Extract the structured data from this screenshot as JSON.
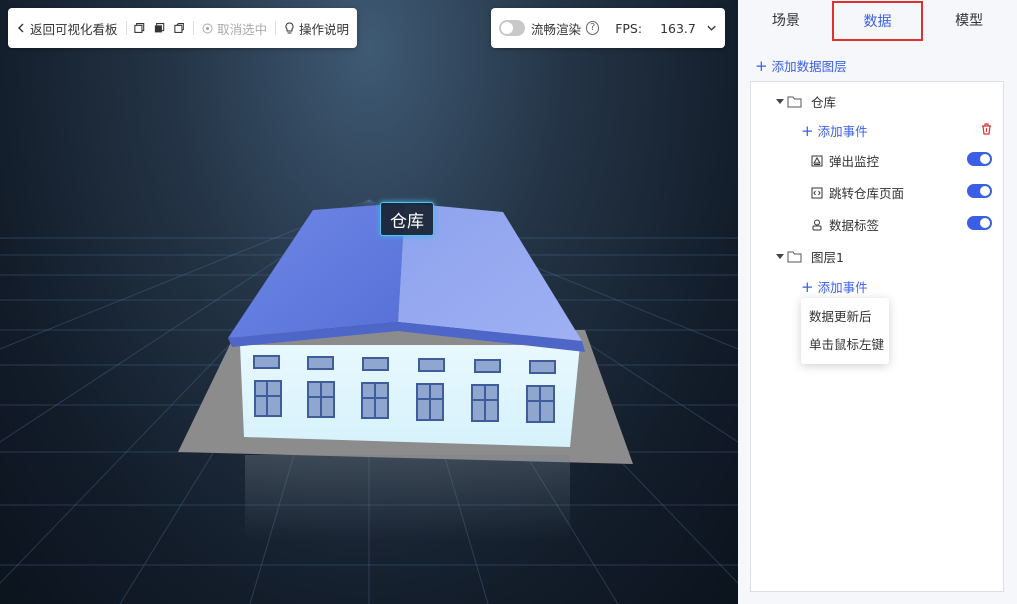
{
  "toolbar": {
    "back_label": "返回可视化看板",
    "cancel_select_label": "取消选中",
    "help_label": "操作说明"
  },
  "fps_bar": {
    "smooth_render_label": "流畅渲染",
    "smooth_render_on": false,
    "fps_label": "FPS:",
    "fps_value": "163.7"
  },
  "scene": {
    "building_label": "仓库"
  },
  "panel": {
    "tabs": [
      {
        "label": "场景",
        "active": false
      },
      {
        "label": "数据",
        "active": true
      },
      {
        "label": "模型",
        "active": false
      }
    ],
    "add_layer_label": "添加数据图层",
    "layers": [
      {
        "name": "仓库",
        "add_event_label": "添加事件",
        "events": [
          {
            "label": "弹出监控",
            "icon": "monitor-icon",
            "enabled": true
          },
          {
            "label": "跳转仓库页面",
            "icon": "code-icon",
            "enabled": true
          },
          {
            "label": "数据标签",
            "icon": "tag-icon",
            "enabled": true
          }
        ]
      },
      {
        "name": "图层1",
        "add_event_label": "添加事件",
        "events": []
      }
    ],
    "event_menu": [
      "数据更新后",
      "单击鼠标左键"
    ]
  },
  "colors": {
    "accent": "#3a5fe6",
    "danger": "#e03030",
    "roof": "#7b93e8",
    "wall": "#dff5ff"
  }
}
